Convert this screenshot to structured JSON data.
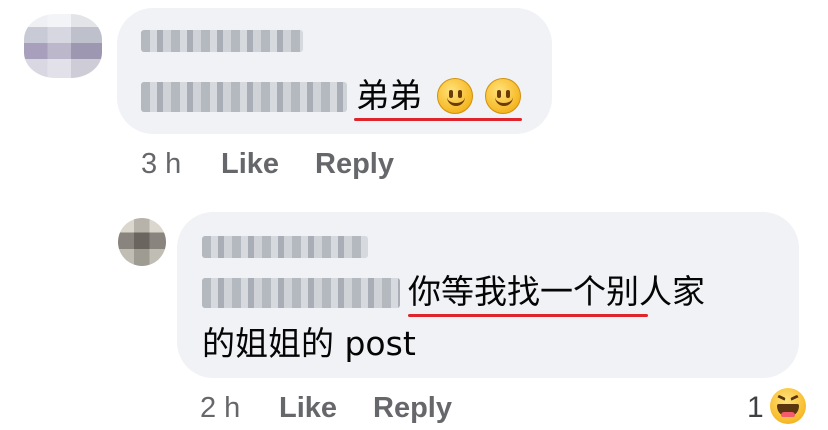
{
  "comment1": {
    "tag_text": "弟弟",
    "emojis": [
      "slightly-smiling-face",
      "slightly-smiling-face"
    ],
    "time": "3 h",
    "like_label": "Like",
    "reply_label": "Reply"
  },
  "comment2": {
    "line1": "你等我找一个别人家",
    "line2": "的姐姐的 post",
    "time": "2 h",
    "like_label": "Like",
    "reply_label": "Reply",
    "reaction_count": "1",
    "reaction_icon": "haha-reaction"
  },
  "colors": {
    "bubble": "#f0f2f5",
    "meta_text": "#65676b",
    "underline": "#e0242b"
  }
}
